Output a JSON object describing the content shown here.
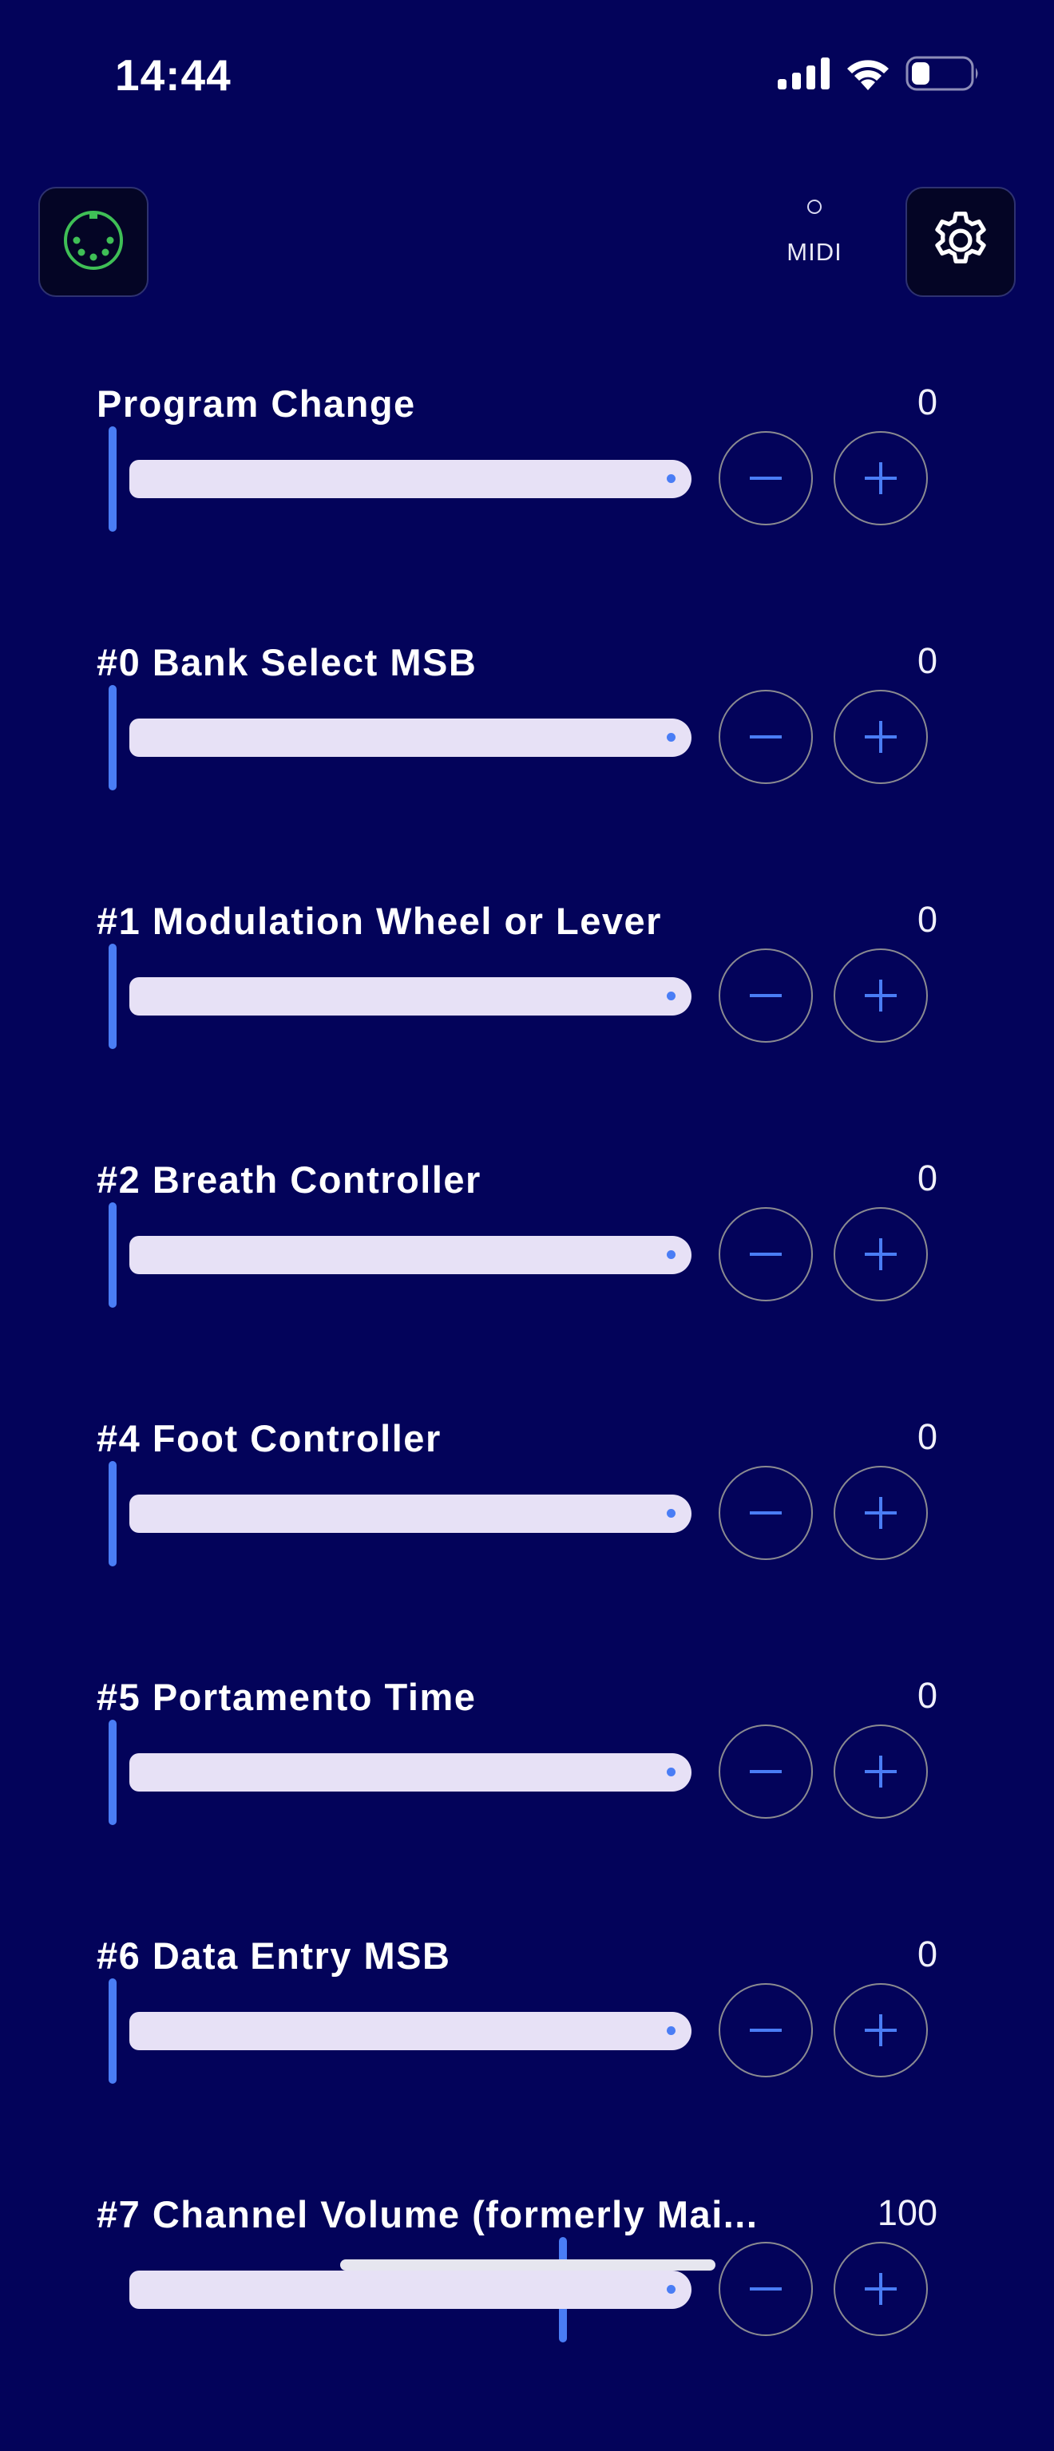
{
  "status_bar": {
    "time": "14:44",
    "icons": [
      "signal-icon",
      "wifi-icon",
      "battery-icon"
    ]
  },
  "header": {
    "midi_connection_icon": "midi-din-connector-icon",
    "midi_label": "MIDI",
    "settings_icon": "gear-icon"
  },
  "colors": {
    "background": "#03035a",
    "accent": "#4a7df5",
    "track": "#e7e1f6",
    "midi_icon_green": "#3fbf56"
  },
  "controls": [
    {
      "name": "Program Change",
      "value": "0",
      "level": 0
    },
    {
      "name": "#0 Bank Select MSB",
      "value": "0",
      "level": 0
    },
    {
      "name": "#1 Modulation Wheel or Lever",
      "value": "0",
      "level": 0
    },
    {
      "name": "#2 Breath Controller",
      "value": "0",
      "level": 0
    },
    {
      "name": "#4 Foot Controller",
      "value": "0",
      "level": 0
    },
    {
      "name": "#5 Portamento Time",
      "value": "0",
      "level": 0
    },
    {
      "name": "#6 Data Entry MSB",
      "value": "0",
      "level": 0
    },
    {
      "name": "#7 Channel Volume (formerly Mai...",
      "value": "100",
      "level": 0.787
    }
  ]
}
